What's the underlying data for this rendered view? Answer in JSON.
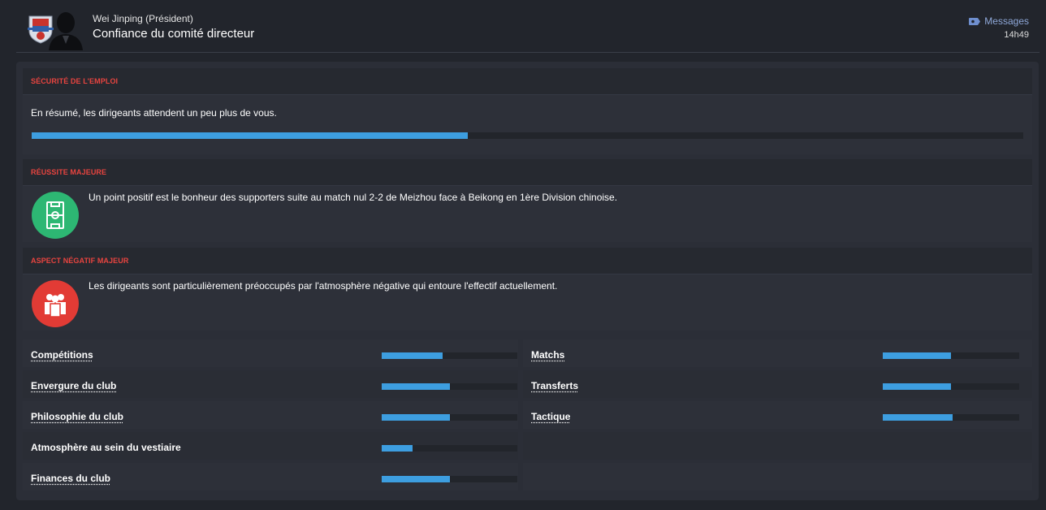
{
  "header": {
    "sender": "Wei Jinping  (Président)",
    "title": "Confiance du comité directeur",
    "messages_label": "Messages",
    "time": "14h49"
  },
  "colors": {
    "accent_red": "#e8443f",
    "bar_fill": "#3d9ee0",
    "success_green": "#2db773",
    "negative_red": "#e23b35"
  },
  "job_security": {
    "title": "SÉCURITÉ DE L'EMPLOI",
    "text": "En résumé, les dirigeants attendent un peu plus de vous.",
    "level": 0.44
  },
  "major_success": {
    "title": "RÉUSSITE MAJEURE",
    "icon": "pitch-icon",
    "text": "Un point positif est le bonheur des supporters suite au match nul 2-2 de Meizhou face à Beikong en 1ère Division chinoise."
  },
  "major_negative": {
    "title": "ASPECT NÉGATIF MAJEUR",
    "icon": "squad-icon",
    "text": "Les dirigeants sont particulièrement préoccupés par l'atmosphère négative qui entoure l'effectif actuellement."
  },
  "ratings": {
    "left": [
      {
        "label": "Compétitions",
        "level": 0.45
      },
      {
        "label": "Envergure du club",
        "level": 0.5
      },
      {
        "label": "Philosophie du club",
        "level": 0.5
      },
      {
        "label": "Atmosphère au sein du vestiaire",
        "level": 0.23
      },
      {
        "label": "Finances du club",
        "level": 0.5
      }
    ],
    "right": [
      {
        "label": "Matchs",
        "level": 0.5
      },
      {
        "label": "Transferts",
        "level": 0.5
      },
      {
        "label": "Tactique",
        "level": 0.51
      }
    ]
  }
}
